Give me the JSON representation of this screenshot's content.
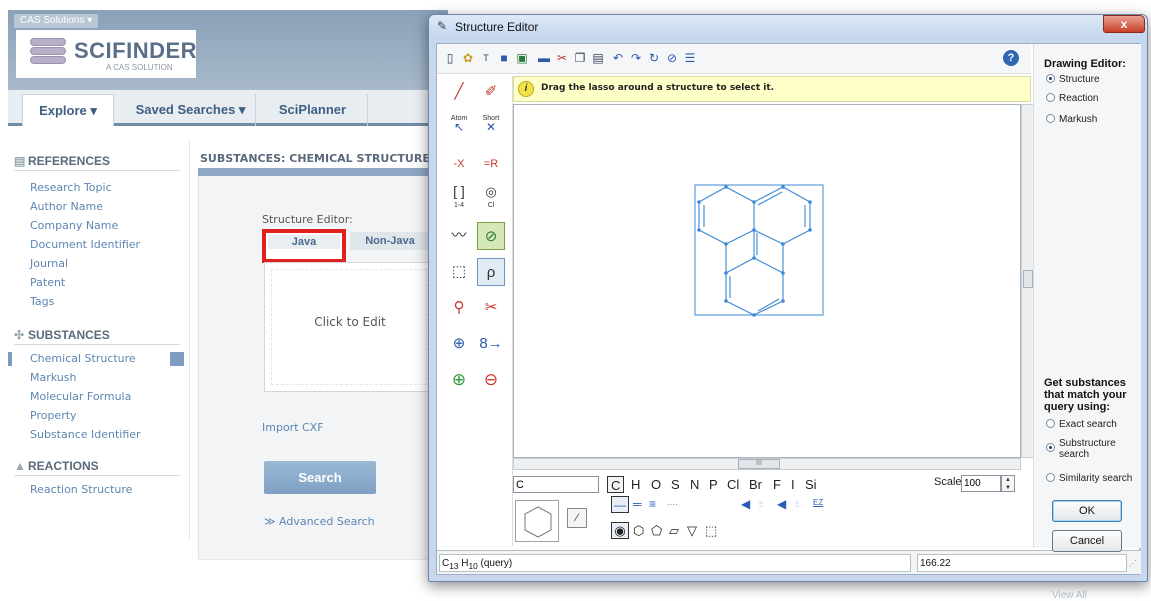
{
  "scifinder": {
    "badge": "CAS Solutions ▾",
    "logo": "SCIFINDER",
    "logo_sub": "A CAS SOLUTION",
    "nav": {
      "explore": "Explore ▾",
      "saved": "Saved Searches ▾",
      "planner": "SciPlanner"
    },
    "sidebar": {
      "references": "REFERENCES",
      "reference_links": [
        "Research Topic",
        "Author Name",
        "Company Name",
        "Document Identifier",
        "Journal",
        "Patent",
        "Tags"
      ],
      "substances": "SUBSTANCES",
      "substance_links": [
        "Chemical Structure",
        "Markush",
        "Molecular Formula",
        "Property",
        "Substance Identifier"
      ],
      "reactions": "REACTIONS",
      "reaction_links": [
        "Reaction Structure"
      ]
    },
    "main": {
      "title": "SUBSTANCES: CHEMICAL STRUCTURE",
      "editor_label": "Structure Editor:",
      "tab_java": "Java",
      "tab_nonjava": "Non-Java",
      "preview": "Click to Edit",
      "import": "Import CXF",
      "search": "Search",
      "advanced": "≫ Advanced Search",
      "view_all": "View All"
    }
  },
  "editor": {
    "title": "Structure Editor",
    "close": "x",
    "hint": "Drag the lasso around a structure to select it.",
    "atom_input": "C",
    "elements": [
      "C",
      "H",
      "O",
      "S",
      "N",
      "P",
      "Cl",
      "Br",
      "F",
      "I",
      "Si"
    ],
    "scale_label": "Scale",
    "scale_value": "100",
    "formula_pre": "C",
    "formula_c": "13",
    "formula_mid": " H",
    "formula_h": "10",
    "formula_post": " (query)",
    "mass": "166.22",
    "tool_labels": {
      "atom": "Atom",
      "short": "Short",
      "x_group": "-X",
      "r_group": "=R",
      "bracket": "1-4",
      "ring_cl": "Cl"
    },
    "options": {
      "drawing_title": "Drawing Editor:",
      "drawing_modes": [
        "Structure",
        "Reaction",
        "Markush"
      ],
      "drawing_selected": 0,
      "match_title_1": "Get substances",
      "match_title_2": "that match your",
      "match_title_3": "query using:",
      "exact": "Exact search",
      "substructure_1": "Substructure",
      "substructure_2": "search",
      "similarity": "Similarity search",
      "ok": "OK",
      "cancel": "Cancel"
    }
  }
}
